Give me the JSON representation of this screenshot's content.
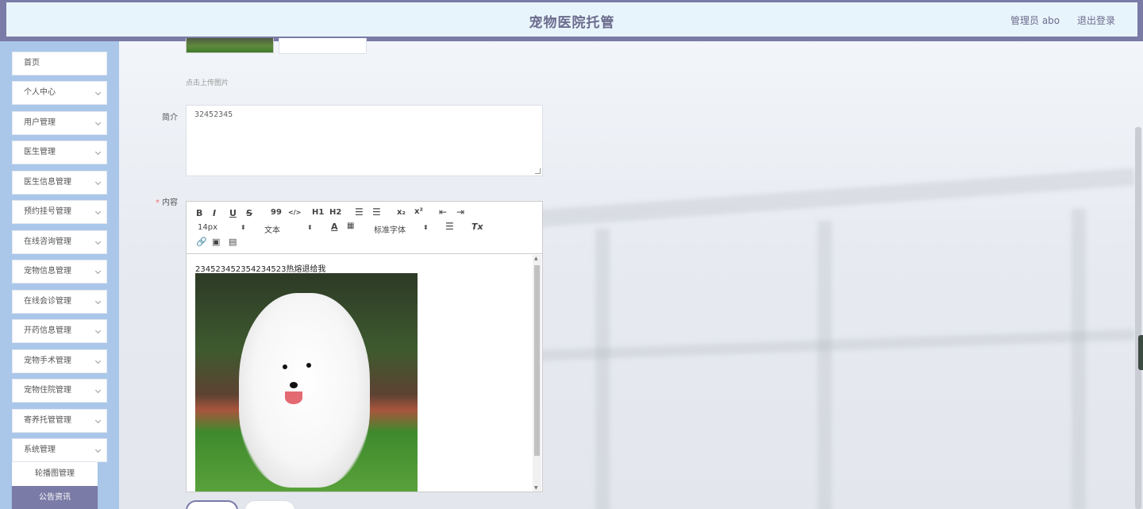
{
  "header": {
    "title": "宠物医院托管",
    "user_label": "管理员 abo",
    "logout": "退出登录"
  },
  "sidebar": {
    "items": [
      {
        "label": "首页"
      },
      {
        "label": "个人中心"
      },
      {
        "label": "用户管理"
      },
      {
        "label": "医生管理"
      },
      {
        "label": "医生信息管理"
      },
      {
        "label": "预约挂号管理"
      },
      {
        "label": "在线咨询管理"
      },
      {
        "label": "宠物信息管理"
      },
      {
        "label": "在线会诊管理"
      },
      {
        "label": "开药信息管理"
      },
      {
        "label": "宠物手术管理"
      },
      {
        "label": "宠物住院管理"
      },
      {
        "label": "寄养托管管理"
      },
      {
        "label": "系统管理"
      }
    ],
    "sub_items": [
      {
        "label": "轮播图管理"
      },
      {
        "label": "公告资讯"
      }
    ]
  },
  "form": {
    "upload_hint": "点击上传图片",
    "intro_label": "简介",
    "intro_value": "32452345",
    "content_label": "内容",
    "content_text": "234523452354234523热熔退给我"
  },
  "editor_toolbar": {
    "bold": "B",
    "italic": "I",
    "underline": "U",
    "strike": "S",
    "quote": "99",
    "code": "</>",
    "h1": "H1",
    "h2": "H2",
    "sub": "x₂",
    "sup": "x²",
    "font_size": "14px",
    "text_type": "文本",
    "font_family": "标准字体",
    "clean": "Tx"
  },
  "colors": {
    "header_bg": "#e8f4fb",
    "header_border": "#7a7ba6",
    "sidebar_bg": "#aac7ea",
    "active_item": "#7a7ba6"
  }
}
